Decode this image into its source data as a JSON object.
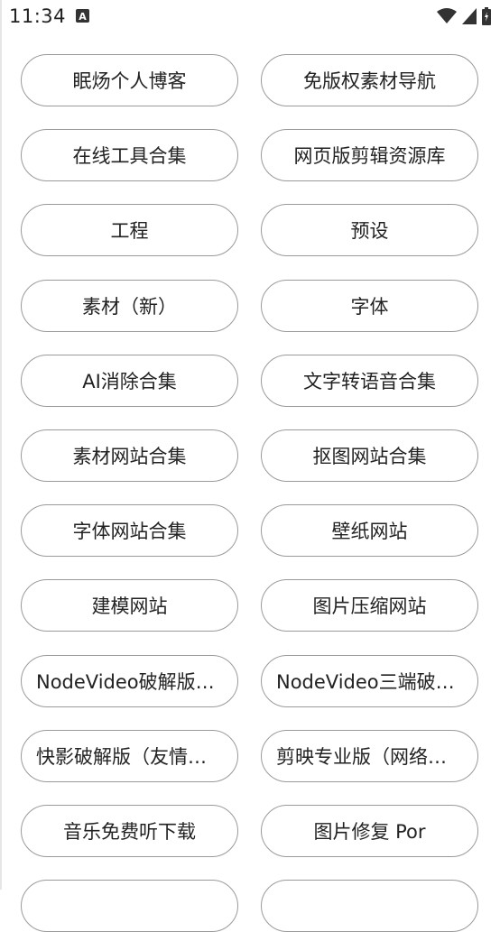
{
  "status_bar": {
    "time": "11:34",
    "icons": [
      "keyboard-a-icon",
      "wifi-icon",
      "signal-icon",
      "battery-icon"
    ]
  },
  "buttons": [
    "眠炀个人博客",
    "免版权素材导航",
    "在线工具合集",
    "网页版剪辑资源库",
    "工程",
    "预设",
    "素材（新）",
    "字体",
    "AI消除合集",
    "文字转语音合集",
    "素材网站合集",
    "抠图网站合集",
    "字体网站合集",
    "壁纸网站",
    "建模网站",
    "图片压缩网站",
    "NodeVideo破解版（…",
    "NodeVideo三端破解…",
    "快影破解版（友情链…",
    "剪映专业版（网络收…",
    "音乐免费听下载",
    "图片修复 Por",
    "",
    ""
  ]
}
